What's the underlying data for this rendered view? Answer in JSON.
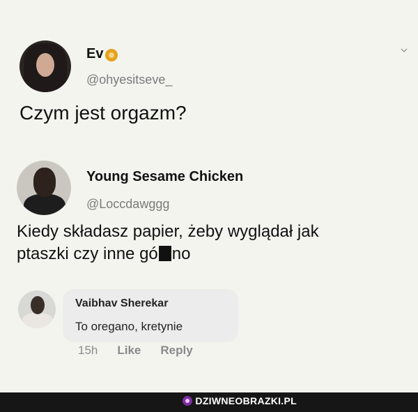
{
  "tweet1": {
    "name": "Ev",
    "badge_icon": "lion-icon",
    "handle": "@ohyesitseve_",
    "text": "Czym jest orgazm?"
  },
  "tweet2": {
    "name": "Young Sesame Chicken",
    "handle": "@Loccdawggg",
    "text_line1": "Kiedy składasz papier, żeby wyglądał jak",
    "text_line2_before": "ptaszki czy inne gó",
    "text_line2_after": "no"
  },
  "comment": {
    "name": "Vaibhav Sherekar",
    "text": "To oregano, kretynie",
    "time": "15h",
    "like_label": "Like",
    "reply_label": "Reply"
  },
  "footer": {
    "logo_text": "DZIWNEOBRAZKI.PL",
    "logo_icon": "site-logo-icon",
    "bar_color": "#161616"
  }
}
